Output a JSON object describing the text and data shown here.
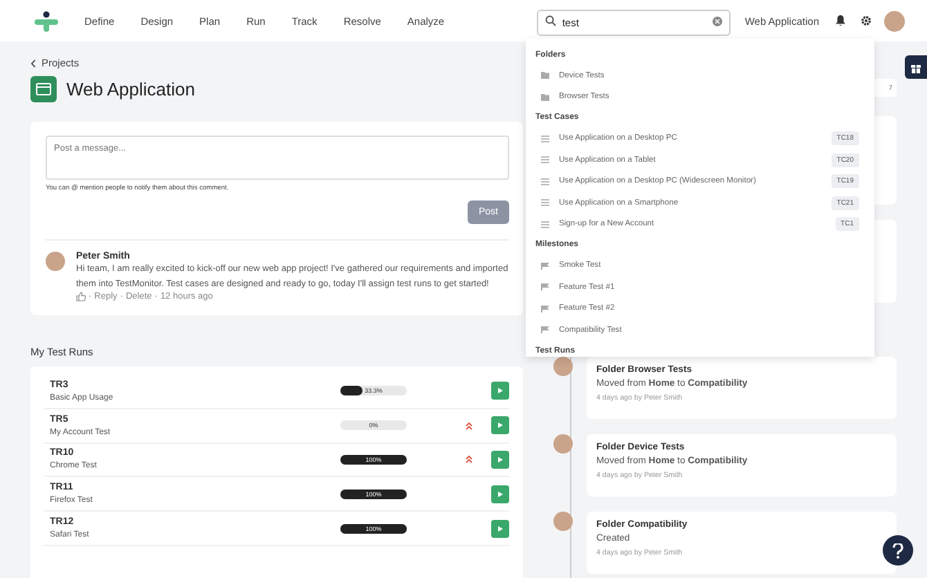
{
  "nav": {
    "items": [
      "Define",
      "Design",
      "Plan",
      "Run",
      "Track",
      "Resolve",
      "Analyze"
    ],
    "search": {
      "value": "test"
    },
    "project": "Web Application"
  },
  "breadcrumb": "Projects",
  "title": "Web Application",
  "composer": {
    "placeholder": "Post a message...",
    "hint": "You can @ mention people to notify them about this comment.",
    "button": "Post"
  },
  "comments": [
    {
      "author": "Peter Smith",
      "text": "Hi team, I am really excited to kick-off our new web app project! I've gathered our requirements and imported them into TestMonitor. Test cases are designed and ready to go, today I'll assign test runs to get started!",
      "separator": "·",
      "actions": [
        "Reply",
        "Delete"
      ],
      "time": "12 hours ago"
    }
  ],
  "test_runs_title": "My Test Runs",
  "test_runs": [
    {
      "id": "TR3",
      "name": "Basic App Usage",
      "level": 0.333,
      "reading": "33.3%",
      "high_priority": false
    },
    {
      "id": "TR5",
      "name": "My Account Test",
      "level": 0,
      "reading": "0%",
      "high_priority": true
    },
    {
      "id": "TR10",
      "name": "Chrome Test",
      "level": 1,
      "reading": "100%",
      "high_priority": true
    },
    {
      "id": "TR11",
      "name": "Firefox Test",
      "level": 1,
      "reading": "100%",
      "high_priority": false
    },
    {
      "id": "TR12",
      "name": "Safari Test",
      "level": 1,
      "reading": "100%",
      "high_priority": false
    }
  ],
  "activity_badge": "7",
  "timeline": [
    {
      "title": "Folder Browser Tests",
      "detail": "Moved from **Home** to **Compatibility**",
      "meta": "4 days ago by Peter Smith"
    },
    {
      "title": "Folder Device Tests",
      "detail": "Moved from **Home** to **Compatibility**",
      "meta": "4 days ago by Peter Smith"
    },
    {
      "title": "Folder Compatibility",
      "detail": "Created",
      "meta": "4 days ago by Peter Smith"
    }
  ],
  "search_results": [
    {
      "title": "Folders",
      "kind": "folder",
      "items": [
        {
          "label": "Device Tests"
        },
        {
          "label": "Browser Tests"
        }
      ]
    },
    {
      "title": "Test Cases",
      "kind": "case",
      "items": [
        {
          "label": "Use Application on a Desktop PC",
          "badge": "TC18"
        },
        {
          "label": "Use Application on a Tablet",
          "badge": "TC20"
        },
        {
          "label": "Use Application on a Desktop PC (Widescreen Monitor)",
          "badge": "TC19"
        },
        {
          "label": "Use Application on a Smartphone",
          "badge": "TC21"
        },
        {
          "label": "Sign-up for a New Account",
          "badge": "TC1"
        }
      ]
    },
    {
      "title": "Milestones",
      "kind": "milestone",
      "items": [
        {
          "label": "Smoke Test"
        },
        {
          "label": "Feature Test #1"
        },
        {
          "label": "Feature Test #2"
        },
        {
          "label": "Compatibility Test"
        }
      ]
    },
    {
      "title": "Test Runs",
      "kind": "run"
    }
  ]
}
